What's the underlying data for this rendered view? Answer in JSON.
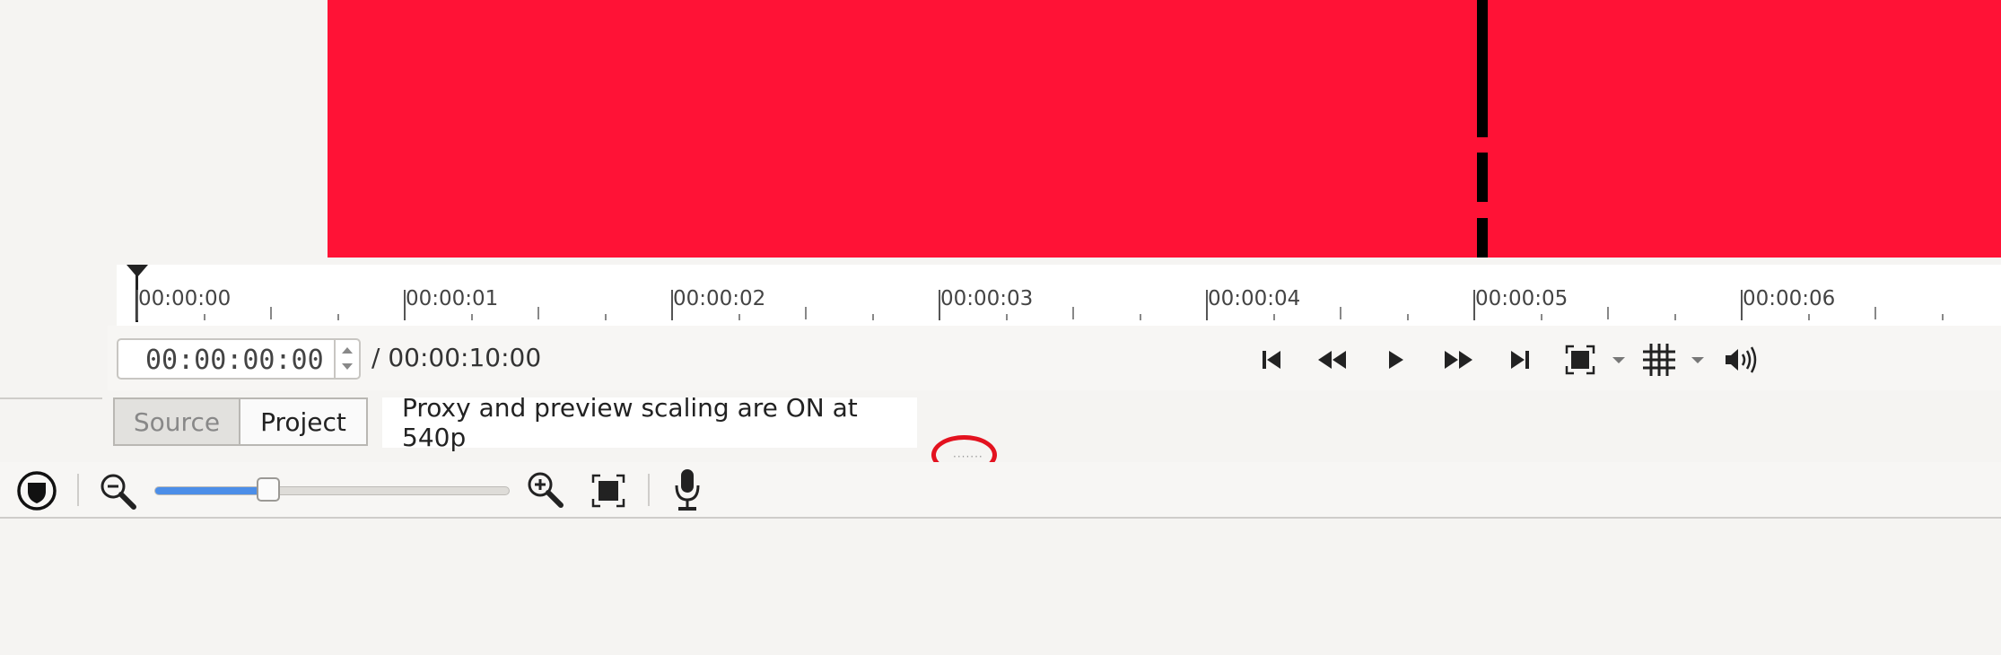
{
  "monitor": {
    "frame_color": "#ff1236",
    "ruler_labels": [
      "00:00:00",
      "00:00:01",
      "00:00:02",
      "00:00:03",
      "00:00:04",
      "00:00:05",
      "00:00:06"
    ]
  },
  "transport": {
    "timecode": "00:00:00:00",
    "duration": "/ 00:00:10:00",
    "buttons": [
      "skip-start-icon",
      "rewind-icon",
      "play-icon",
      "fast-forward-icon",
      "skip-end-icon",
      "zoom-fit-icon",
      "grid-icon",
      "volume-icon"
    ]
  },
  "tabs": {
    "source": "Source",
    "project": "Project"
  },
  "notice": "Proxy and preview scaling are ON at 540p",
  "timeline_toolbar": {
    "zoom_level_fraction": 0.32,
    "accent": "#4c8ee8"
  },
  "highlight_color": "#e3121f"
}
